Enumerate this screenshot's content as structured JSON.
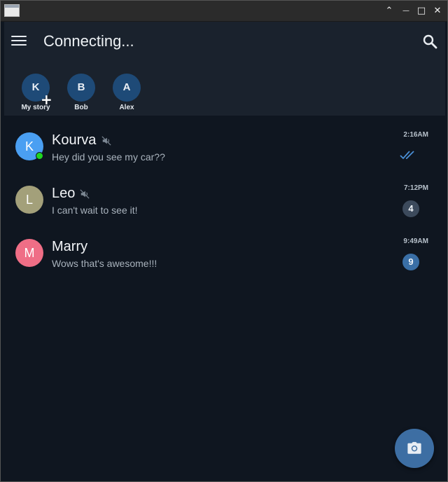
{
  "window": {
    "controls": [
      "minimize-up",
      "minimize",
      "maximize",
      "close"
    ],
    "glyphs": {
      "up": "⌃",
      "min": "—",
      "max": "□",
      "close": "✕"
    }
  },
  "header": {
    "title": "Connecting...",
    "menu_icon": "hamburger-icon",
    "search_icon": "search-icon"
  },
  "stories": [
    {
      "initial": "K",
      "name": "My story",
      "add": "+"
    },
    {
      "initial": "B",
      "name": "Bob"
    },
    {
      "initial": "A",
      "name": "Alex"
    }
  ],
  "chats": [
    {
      "initial": "K",
      "name": "Kourva",
      "muted": true,
      "online": true,
      "message": "Hey did you see my car??",
      "time": "2:16AM",
      "status": "read",
      "avatar_color": "#4a9ff2"
    },
    {
      "initial": "L",
      "name": "Leo",
      "muted": true,
      "online": false,
      "message": "I can't wait to see it!",
      "time": "7:12PM",
      "unread": "4",
      "badge_color": "#3c4a5c",
      "avatar_color": "#a3a07a"
    },
    {
      "initial": "M",
      "name": "Marry",
      "muted": false,
      "online": false,
      "message": "Wows that's awesome!!!",
      "time": "9:49AM",
      "unread": "9",
      "badge_color": "#3a6fa6",
      "avatar_color": "#ef6e86"
    }
  ],
  "fab": {
    "icon": "camera-icon"
  },
  "colors": {
    "background": "#0f1620",
    "header": "#1a222d",
    "accent": "#3d6ea3",
    "online": "#1fd61f"
  }
}
